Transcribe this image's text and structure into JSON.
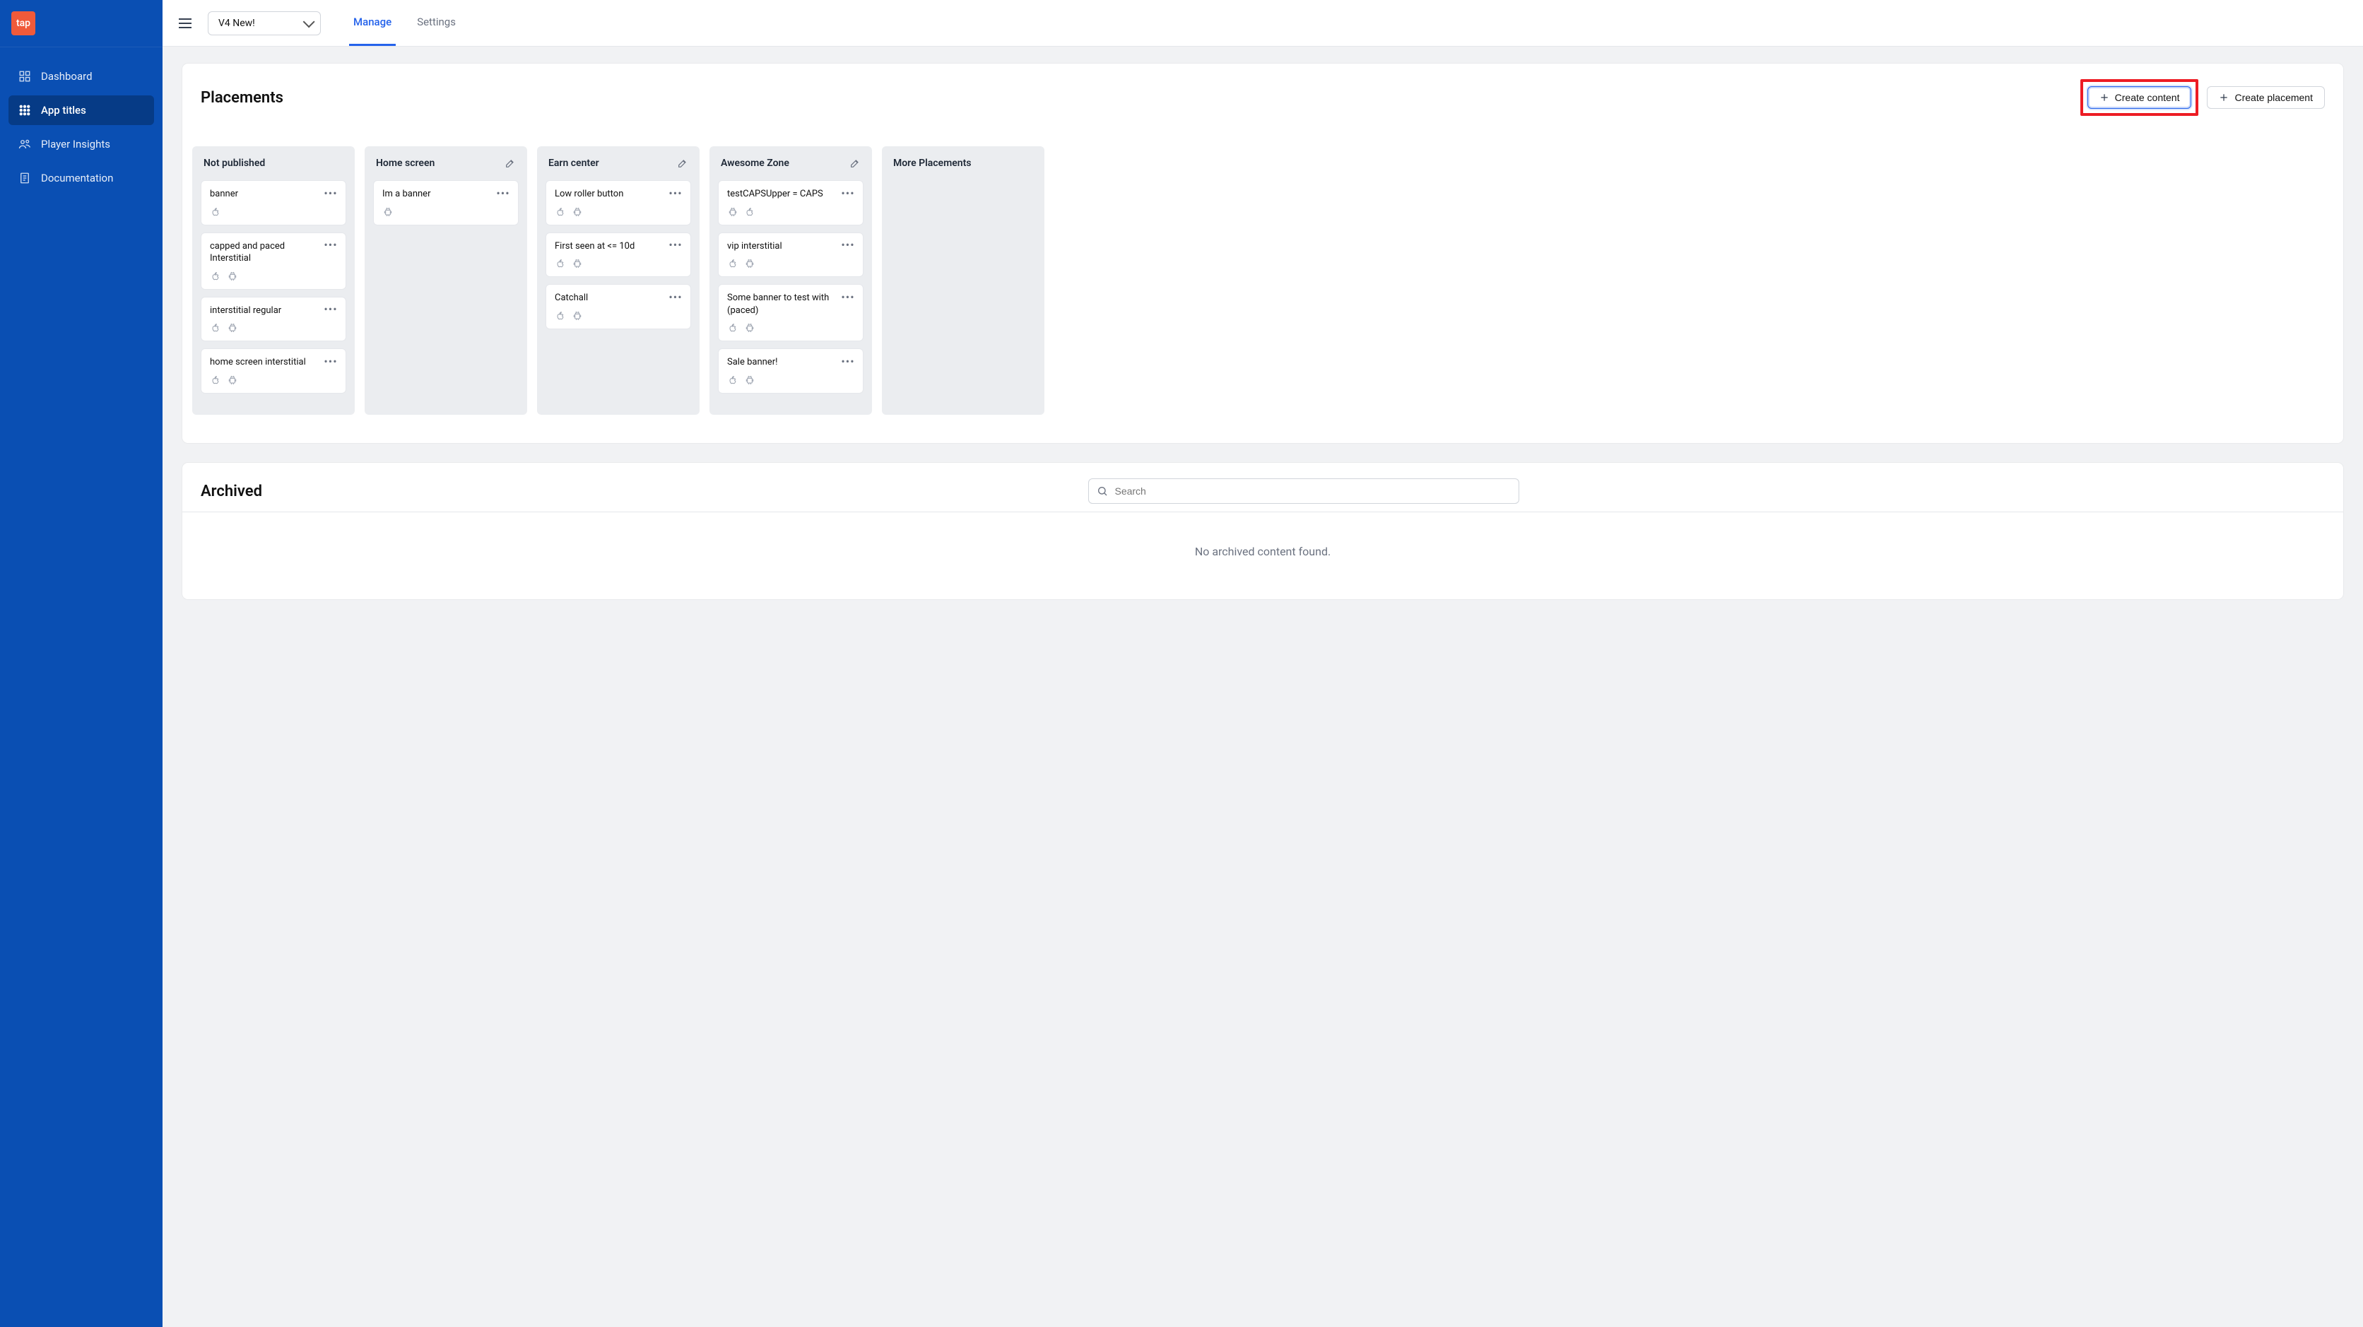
{
  "brand": {
    "logo_text": "tap"
  },
  "sidebar": {
    "items": [
      {
        "label": "Dashboard",
        "icon": "dashboard"
      },
      {
        "label": "App titles",
        "icon": "grid"
      },
      {
        "label": "Player Insights",
        "icon": "people"
      },
      {
        "label": "Documentation",
        "icon": "doc"
      }
    ]
  },
  "topbar": {
    "app_selector_value": "V4 New!",
    "tabs": [
      {
        "label": "Manage",
        "active": true
      },
      {
        "label": "Settings",
        "active": false
      }
    ]
  },
  "placements": {
    "title": "Placements",
    "create_content_label": "Create content",
    "create_placement_label": "Create placement",
    "columns": [
      {
        "title": "Not published",
        "editable": false,
        "items": [
          {
            "title": "banner",
            "platforms": [
              "apple"
            ]
          },
          {
            "title": "capped and paced Interstitial",
            "platforms": [
              "apple",
              "android"
            ]
          },
          {
            "title": "interstitial regular",
            "platforms": [
              "apple",
              "android"
            ]
          },
          {
            "title": "home screen interstitial",
            "platforms": [
              "apple",
              "android"
            ]
          }
        ]
      },
      {
        "title": "Home screen",
        "editable": true,
        "items": [
          {
            "title": "Im a banner",
            "platforms": [
              "android"
            ]
          }
        ]
      },
      {
        "title": "Earn center",
        "editable": true,
        "items": [
          {
            "title": "Low roller button",
            "platforms": [
              "apple",
              "android"
            ]
          },
          {
            "title": "First seen at <= 10d",
            "platforms": [
              "apple",
              "android"
            ]
          },
          {
            "title": "Catchall",
            "platforms": [
              "apple",
              "android"
            ]
          }
        ]
      },
      {
        "title": "Awesome Zone",
        "editable": true,
        "items": [
          {
            "title": "testCAPSUpper = CAPS",
            "platforms": [
              "android",
              "apple"
            ]
          },
          {
            "title": "vip interstitial",
            "platforms": [
              "apple",
              "android"
            ]
          },
          {
            "title": "Some banner to test with (paced)",
            "platforms": [
              "apple",
              "android"
            ]
          },
          {
            "title": "Sale banner!",
            "platforms": [
              "apple",
              "android"
            ]
          }
        ]
      },
      {
        "title": "More Placements",
        "editable": false,
        "items": []
      }
    ]
  },
  "archived": {
    "title": "Archived",
    "search_placeholder": "Search",
    "empty_message": "No archived content found."
  }
}
